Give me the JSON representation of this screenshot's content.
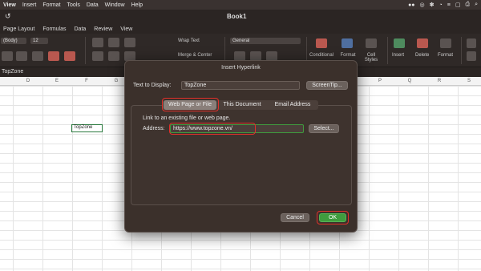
{
  "menubar": {
    "items": [
      "View",
      "Insert",
      "Format",
      "Tools",
      "Data",
      "Window",
      "Help"
    ],
    "tray": [
      "●●",
      "◎",
      "✽",
      "◔",
      "≡",
      "▢",
      "⎙",
      "⌕"
    ]
  },
  "window": {
    "title": "Book1",
    "undo_icon": "↺"
  },
  "ribbon_tabs": [
    "Page Layout",
    "Formulas",
    "Data",
    "Review",
    "View"
  ],
  "ribbon": {
    "font_name": "(Body)",
    "font_size": "12",
    "wrap_text": "Wrap Text",
    "merge_center": "Merge & Center",
    "number_format": "General",
    "conditional": "Conditional",
    "format_as": "Format",
    "cell_styles": "Cell Styles",
    "insert": "Insert",
    "delete": "Delete",
    "format": "Format"
  },
  "formula_bar": {
    "name_box": "TopZone"
  },
  "sheet": {
    "columns": [
      "D",
      "E",
      "F",
      "G",
      "",
      "",
      "",
      "",
      "",
      "",
      "P",
      "Q",
      "R",
      "S"
    ],
    "selected_cell_value": "TopZone"
  },
  "dialog": {
    "title": "Insert Hyperlink",
    "text_to_display_label": "Text to Display:",
    "text_to_display_value": "TopZone",
    "screentip_button": "ScreenTip...",
    "tabs": [
      "Web Page or File",
      "This Document",
      "Email Address"
    ],
    "active_tab": "Web Page or File",
    "hint": "Link to an existing file or web page.",
    "address_label": "Address:",
    "address_value": "https://www.topzone.vn/",
    "select_button": "Select...",
    "cancel_button": "Cancel",
    "ok_button": "OK"
  },
  "colors": {
    "highlight": "#e0302a",
    "ok": "#3f9c3e",
    "dialog_bg": "#3b302b"
  }
}
